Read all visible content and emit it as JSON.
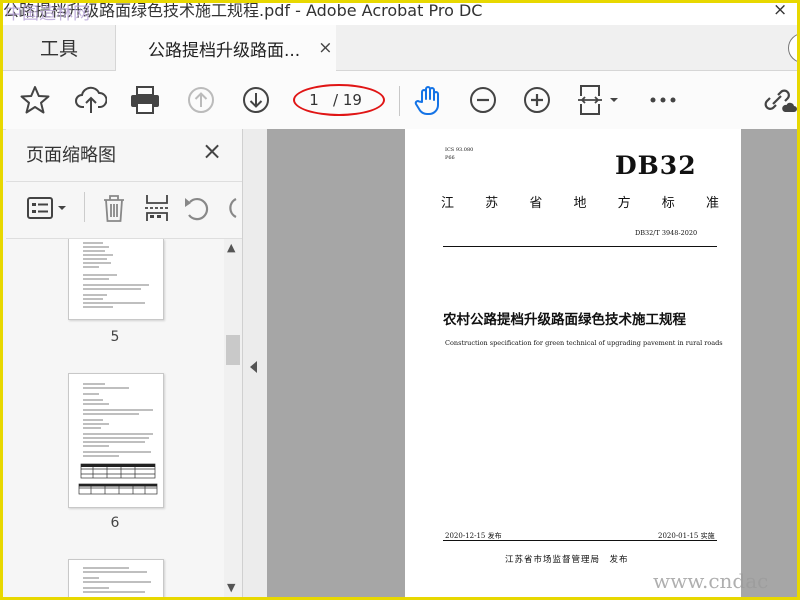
{
  "window": {
    "title": "公路提档升级路面绿色技术施工规程.pdf - Adobe Acrobat Pro DC",
    "watermark_top": "中国造林网",
    "close_glyph": "×"
  },
  "tabs": [
    {
      "label": "工具"
    },
    {
      "label": "公路提档升级路面...",
      "close": "×"
    }
  ],
  "toolbar": {
    "page_current": "1",
    "page_total": "/ 19"
  },
  "icons": {
    "bookmark": "star-icon",
    "upload": "cloud-upload-icon",
    "print": "print-icon",
    "prev": "arrow-up-circle-icon",
    "next": "arrow-down-circle-icon",
    "hand": "hand-icon",
    "zoom_out": "zoom-out-icon",
    "zoom_in": "zoom-in-icon",
    "fit": "fit-page-icon",
    "more": "more-icon",
    "share": "link-share-icon"
  },
  "panel": {
    "title": "页面缩略图",
    "close": "×",
    "thumbnails": [
      {
        "page": "5"
      },
      {
        "page": "6"
      }
    ]
  },
  "document": {
    "ics": "ICS 93.080",
    "classification": "P66",
    "code": "DB32",
    "standard_type": [
      "江",
      "苏",
      "省",
      "地",
      "方",
      "标",
      "准"
    ],
    "number": "DB32/T 3948-2020",
    "title_cn": "农村公路提档升级路面绿色技术施工规程",
    "title_en": "Construction specification for green technical of upgrading pavement in rural roads",
    "issue_date": "2020-12-15 发布",
    "impl_date": "2020-01-15 实施",
    "publisher": "江苏省市场监督管理局　发布"
  },
  "watermark_bottom": "www.cndac",
  "colors": {
    "accent_red": "#e01515",
    "frame": "#e8d800"
  }
}
